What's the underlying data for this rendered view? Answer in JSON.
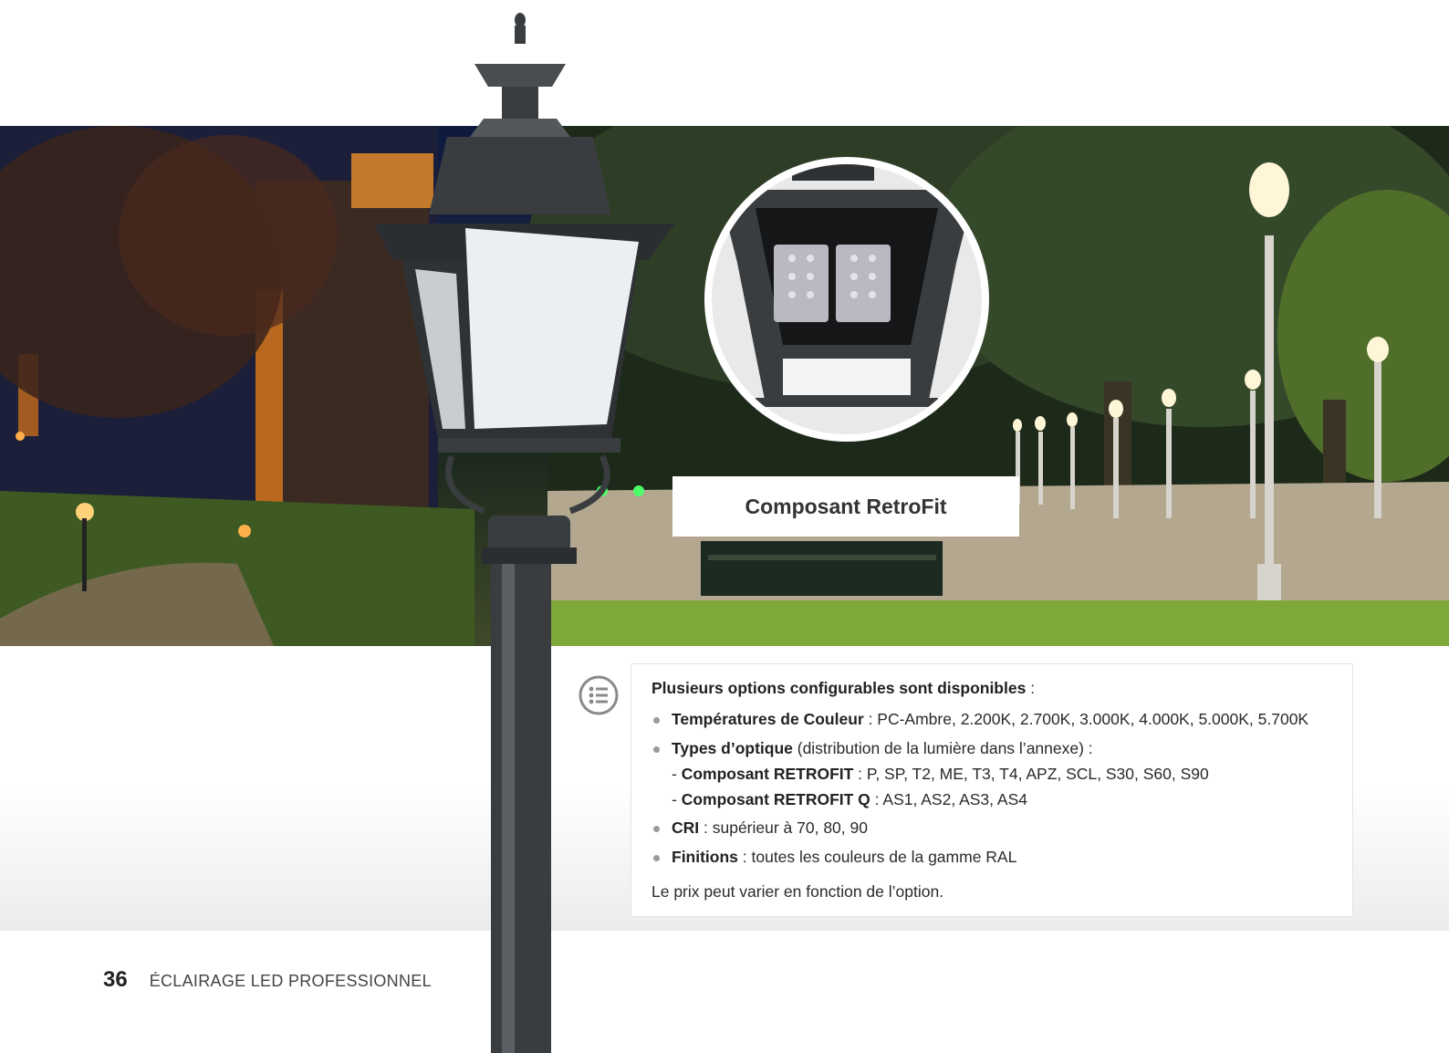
{
  "caption": "Composant RetroFit",
  "options": {
    "intro_bold": "Plusieurs options configurables sont disponibles",
    "intro_rest": " :",
    "items": [
      {
        "label": "Températures de Couleur",
        "text": " : PC-Ambre, 2.200K, 2.700K, 3.000K, 4.000K, 5.000K, 5.700K"
      },
      {
        "label": "Types d’optique",
        "text": " (distribution de la lumière dans l’annexe) :"
      },
      {
        "label": "CRI",
        "text": " : supérieur à 70, 80, 90"
      },
      {
        "label": "Finitions",
        "text": " : toutes les couleurs de la gamme RAL"
      }
    ],
    "optics_sub": [
      {
        "prefix": "- ",
        "label": "Composant RETROFIT",
        "text": " : P, SP, T2, ME, T3, T4, APZ, SCL, S30, S60, S90"
      },
      {
        "prefix": "- ",
        "label": "Composant RETROFIT Q",
        "text": " : AS1, AS2, AS3, AS4"
      }
    ],
    "note": "Le prix peut varier en fonction de l’option."
  },
  "footer": {
    "page_number": "36",
    "title": "ÉCLAIRAGE LED PROFESSIONNEL"
  },
  "icons": {
    "list": "list-icon"
  },
  "colors": {
    "card_border": "#e3e3e3",
    "bullet": "#9a9a9a",
    "lamp_metal": "#3a3d40"
  }
}
